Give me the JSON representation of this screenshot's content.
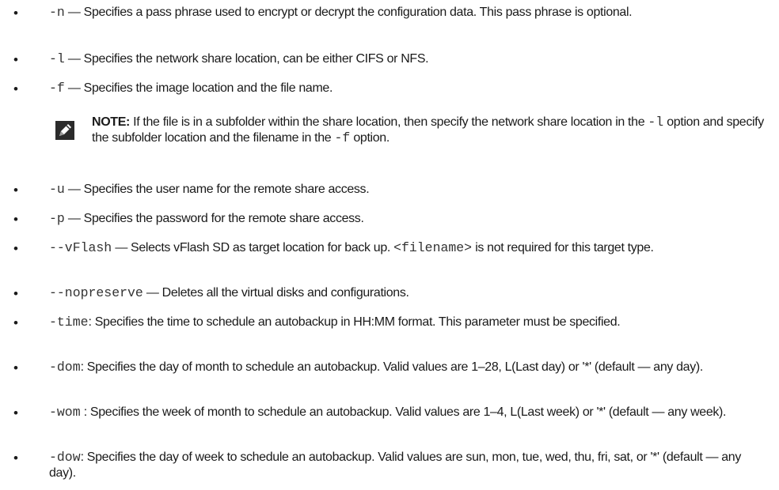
{
  "list": {
    "items": [
      {
        "code": "-n",
        "desc": " — Specifies a pass phrase used to encrypt or decrypt the configuration data. This pass phrase is optional."
      },
      {
        "code": "-l",
        "desc": " — Specifies the network share location, can be either CIFS or NFS."
      },
      {
        "code": "-f",
        "desc": " — Specifies the image location and the file name."
      },
      {
        "code": "-u",
        "desc": " — Specifies the user name for the remote share access."
      },
      {
        "code": "-p",
        "desc": " — Specifies the password for the remote share access."
      },
      {
        "code": "--vFlash",
        "desc": " — Selects vFlash SD as target location for back up. ",
        "code2": "<filename>",
        "desc2": " is not required for this target type."
      },
      {
        "code": "--nopreserve",
        "desc": " — Deletes all the virtual disks and configurations."
      },
      {
        "code": "-time",
        "desc": ": Specifies the time to schedule an autobackup in HH:MM format. This parameter must be specified."
      },
      {
        "code": "-dom",
        "desc": ": Specifies the day of month to schedule an autobackup. Valid values are 1–28, L(Last day) or '*' (default — any day)."
      },
      {
        "code": "-wom",
        "desc": " : Specifies the week of month to schedule an autobackup. Valid values are 1–4, L(Last week) or '*' (default — any week)."
      },
      {
        "code": "-dow",
        "desc": ": Specifies the day of week to schedule an autobackup. Valid values are sun, mon, tue, wed, thu, fri, sat, or '*' (default — any day)."
      }
    ],
    "bullet": "•"
  },
  "note": {
    "label": "NOTE:",
    "text1": " If the file is in a subfolder within the share location, then specify the network share location in the ",
    "code1": "-l",
    "text2": " option and specify the subfolder location and the filename in the ",
    "code2": "-f",
    "text3": " option.",
    "icon": "pencil-note-icon"
  }
}
